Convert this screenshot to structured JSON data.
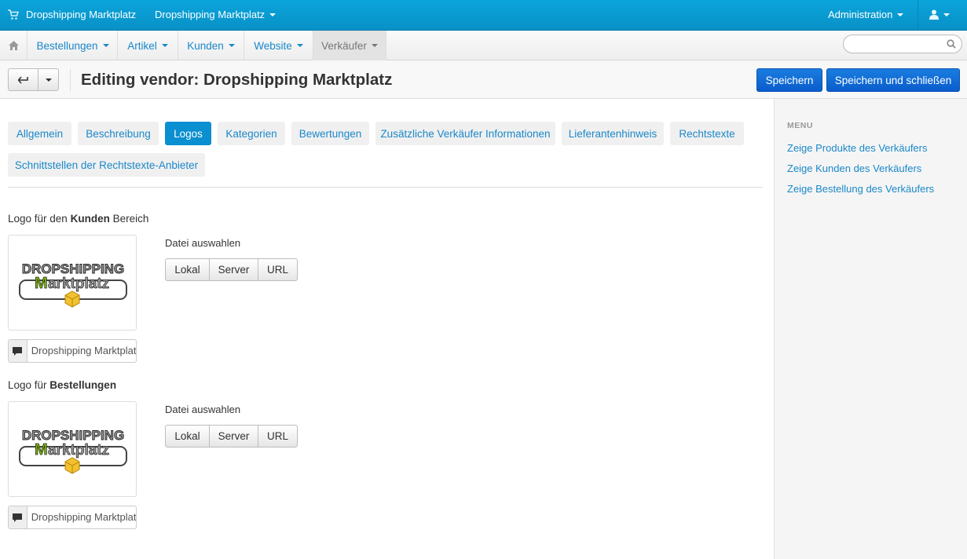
{
  "topbar": {
    "brand": "Dropshipping Marktplatz",
    "store_menu": "Dropshipping Marktplatz",
    "admin_menu": "Administration"
  },
  "nav": {
    "items": [
      "Bestellungen",
      "Artikel",
      "Kunden",
      "Website",
      "Verkäufer"
    ],
    "active": "Verkäufer",
    "search_value": ""
  },
  "toolbar": {
    "title": "Editing vendor: Dropshipping Marktplatz",
    "save_label": "Speichern",
    "save_close_label": "Speichern und schließen"
  },
  "tabs": {
    "items": [
      "Allgemein",
      "Beschreibung",
      "Logos",
      "Kategorien",
      "Bewertungen",
      "Zusätzliche Verkäufer Informationen",
      "Lieferantenhinweis",
      "Rechtstexte",
      "Schnittstellen der Rechtstexte-Anbieter"
    ],
    "active": "Logos"
  },
  "sections": [
    {
      "title_pre": "Logo für den ",
      "title_bold": "Kunden",
      "title_post": " Bereich",
      "file_label": "Datei auswahlen",
      "buttons": [
        "Lokal",
        "Server",
        "URL"
      ],
      "caption_value": "Dropshipping Marktplatz",
      "logo_line1": "DROPSHIPPING",
      "logo_m": "M",
      "logo_line2": "arktplatz"
    },
    {
      "title_pre": "Logo für ",
      "title_bold": "Bestellungen",
      "title_post": "",
      "file_label": "Datei auswahlen",
      "buttons": [
        "Lokal",
        "Server",
        "URL"
      ],
      "caption_value": "Dropshipping Marktplatz",
      "logo_line1": "DROPSHIPPING",
      "logo_m": "M",
      "logo_line2": "arktplatz"
    }
  ],
  "sidebar": {
    "menu_title": "MENU",
    "links": [
      "Zeige Produkte des Verkäufers",
      "Zeige Kunden des Verkäufers",
      "Zeige Bestellung des Verkäufers"
    ]
  },
  "colors": {
    "topbar": "#0aa5db",
    "link": "#1a88c9",
    "active_tab": "#0a8fd0",
    "primary_button": "#0a5ccc",
    "logo_green": "#7ab800",
    "logo_box": "#f2c12e"
  },
  "icons": {
    "brand": "cart-icon",
    "home": "home-icon",
    "user": "user-icon",
    "search": "search-icon",
    "back": "back-arrow-icon",
    "caption": "comment-icon"
  }
}
